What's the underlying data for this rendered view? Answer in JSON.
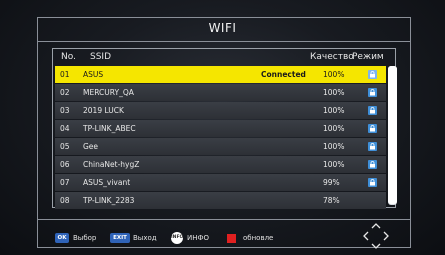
{
  "header": {
    "title": "WIFI"
  },
  "columns": {
    "no": "No.",
    "ssid": "SSID",
    "quality": "Качество",
    "mode": "Режим"
  },
  "networks": [
    {
      "no": "01",
      "ssid": "ASUS",
      "status": "Connected",
      "quality": "100%",
      "locked": true,
      "selected": true
    },
    {
      "no": "02",
      "ssid": "MERCURY_QA",
      "status": "",
      "quality": "100%",
      "locked": true
    },
    {
      "no": "03",
      "ssid": "2019 LUCK",
      "status": "",
      "quality": "100%",
      "locked": true
    },
    {
      "no": "04",
      "ssid": "TP-LINK_ABEC",
      "status": "",
      "quality": "100%",
      "locked": true
    },
    {
      "no": "05",
      "ssid": "Gee",
      "status": "",
      "quality": "100%",
      "locked": true
    },
    {
      "no": "06",
      "ssid": "ChinaNet-hygZ",
      "status": "",
      "quality": "100%",
      "locked": true
    },
    {
      "no": "07",
      "ssid": "ASUS_vivant",
      "status": "",
      "quality": "99%",
      "locked": true
    },
    {
      "no": "08",
      "ssid": "TP-LINK_2283",
      "status": "",
      "quality": "78%",
      "locked": false
    }
  ],
  "footer": {
    "ok_key": "OK",
    "ok_label": "Выбор",
    "exit_key": "EXIT",
    "exit_label": "Выход",
    "info_key": "INFO",
    "info_label": "ИНФО",
    "refresh_label": "обновле"
  },
  "colors": {
    "selected_row": "#f5e600",
    "lock_icon": "#3f8fd8",
    "key_blue": "#2f63b8",
    "key_red": "#e02020"
  }
}
